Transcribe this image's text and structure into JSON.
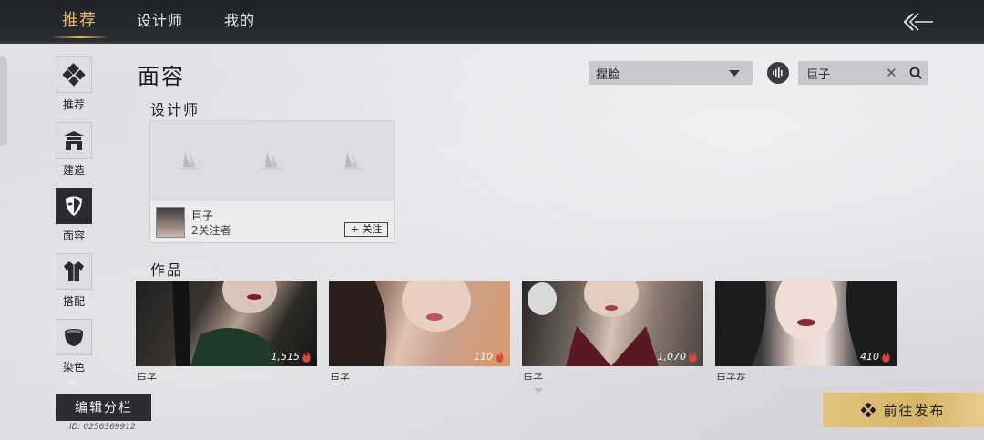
{
  "tabs": [
    {
      "label": "推荐",
      "active": true
    },
    {
      "label": "设计师",
      "active": false
    },
    {
      "label": "我的",
      "active": false
    }
  ],
  "sidebar": {
    "items": [
      {
        "label": "推荐",
        "icon": "recommend-diamond-icon",
        "active": false
      },
      {
        "label": "建造",
        "icon": "building-icon",
        "active": false
      },
      {
        "label": "面容",
        "icon": "mask-icon",
        "active": true
      },
      {
        "label": "搭配",
        "icon": "outfit-icon",
        "active": false
      },
      {
        "label": "染色",
        "icon": "dye-bowl-icon",
        "active": false
      }
    ]
  },
  "main": {
    "title": "面容",
    "filter": {
      "selected": "捏脸"
    },
    "search": {
      "value": "巨子"
    },
    "designers_section": "设计师",
    "designer": {
      "name": "巨子",
      "followers": "2关注者",
      "follow_label": "+ 关注"
    },
    "works_section": "作品",
    "works": [
      {
        "likes": "1,515",
        "name": "巨子"
      },
      {
        "likes": "110",
        "name": "巨子"
      },
      {
        "likes": "1,070",
        "name": "巨子"
      },
      {
        "likes": "410",
        "name": "巨子花"
      }
    ]
  },
  "footer": {
    "edit_label": "编辑分栏",
    "user_id": "ID: 0256369912",
    "publish_label": "前往发布"
  },
  "colors": {
    "accent_gold": "#e3b96a",
    "publish_bg": "#d8b466",
    "active_nav": "#2a2b2f",
    "flame": "#e0463a"
  }
}
